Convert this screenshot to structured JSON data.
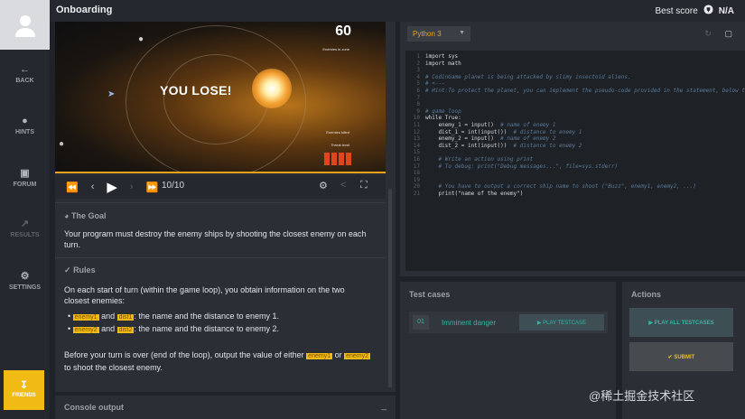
{
  "header": {
    "title": "Onboarding",
    "best_score_label": "Best score",
    "best_score_value": "N/A"
  },
  "sidebar": {
    "items": [
      {
        "label": "BACK",
        "icon": "arrow-left-icon"
      },
      {
        "label": "HINTS",
        "icon": "lightbulb-icon"
      },
      {
        "label": "FORUM",
        "icon": "chat-icon"
      },
      {
        "label": "RESULTS",
        "icon": "chart-icon"
      },
      {
        "label": "SETTINGS",
        "icon": "gear-icon"
      }
    ],
    "friends_label": "FRIENDS"
  },
  "viewer": {
    "overlay_text": "YOU LOSE!",
    "score": "60",
    "enemies_in_zone": "Enemies in zone",
    "enemies_killed": "Enemies killed",
    "threat_level": "Threat level",
    "frame": "10/10"
  },
  "statement": {
    "goal_title": "The Goal",
    "goal_text": "Your program must destroy the enemy ships by shooting the closest enemy on each turn.",
    "rules_title": "Rules",
    "rules_text": "On each start of turn (within the game loop), you obtain information on the two closest enemies:",
    "rules_bullets": [
      {
        "a": "enemy1",
        "and": " and ",
        "b": "dist1",
        "rest": ": the name and the distance to enemy 1."
      },
      {
        "a": "enemy2",
        "and": " and ",
        "b": "dist2",
        "rest": ": the name and the distance to enemy 2."
      }
    ],
    "output_text_1": "Before your turn is over (end of the loop), output the value of either ",
    "output_hl_1": "enemy1",
    "output_or": " or",
    "output_hl_2": "enemy2",
    "output_text_2": " to shoot the closest enemy."
  },
  "console": {
    "title": "Console output",
    "minimize": "_"
  },
  "editor": {
    "language": "Python 3",
    "line_numbers": [
      "1",
      "2",
      "3",
      "4",
      "5",
      "6",
      "7",
      "8",
      "9",
      "10",
      "11",
      "12",
      "13",
      "14",
      "15",
      "16",
      "17",
      "18",
      "19",
      "20",
      "21"
    ],
    "code_lines": [
      "import sys",
      "import math",
      "",
      "# CodinGame planet is being attacked by slimy insectoid aliens.",
      "# <---",
      "# Hint:To protect the planet, you can implement the pseudo-code provided in the statement, below the player.",
      "",
      "",
      "# game loop",
      "while True:",
      "    enemy_1 = input()  # name of enemy 1",
      "    dist_1 = int(input())  # distance to enemy 1",
      "    enemy_2 = input()  # name of enemy 2",
      "    dist_2 = int(input())  # distance to enemy 2",
      "",
      "    # Write an action using print",
      "    # To debug: print(\"Debug messages...\", file=sys.stderr)",
      "",
      "",
      "    # You have to output a correct ship name to shoot (\"Buzz\", enemy1, enemy2, ...)",
      "    print(\"name of the enemy\")"
    ]
  },
  "tests": {
    "title": "Test cases",
    "rows": [
      {
        "num": "01",
        "name": "Imminent danger",
        "button": "▶ PLAY TESTCASE"
      }
    ]
  },
  "actions": {
    "title": "Actions",
    "play_all": "▶ PLAY ALL TESTCASES",
    "submit": "✔ SUBMIT"
  },
  "watermark": "@稀土掘金技术社区",
  "colors": {
    "accent": "#f2bb13",
    "teal": "#2fb8a4",
    "bg": "#1f2228"
  }
}
